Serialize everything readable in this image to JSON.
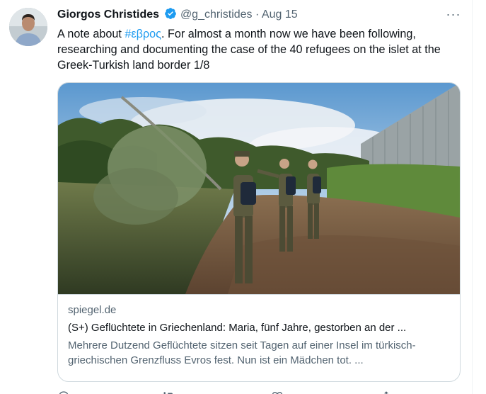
{
  "tweet": {
    "author_name": "Giorgos Christides",
    "handle": "@g_christides",
    "separator": "·",
    "date": "Aug 15",
    "more_glyph": "···",
    "text_hashtag": "#εβρος",
    "text_lead": "A note about ",
    "text_rest": ".  For almost a month now we have been following, researching and documenting the case of the 40 refugees on the islet at the Greek-Turkish land border 1/8"
  },
  "card": {
    "domain": "spiegel.de",
    "title": "(S+) Geflüchtete in Griechenland: Maria, fünf Jahre, gestorben an der ...",
    "description": "Mehrere Dutzend Geflüchtete sitzen seit Tagen auf einer Insel im türkisch-griechischen Grenzfluss Evros fest. Nun ist ein Mädchen tot. ..."
  },
  "colors": {
    "accent": "#1d9bf0",
    "text_primary": "#0f1419",
    "text_secondary": "#536471",
    "border": "#cfd9de"
  },
  "icons": [
    "verified-badge-icon",
    "more-icon",
    "reply-icon",
    "retweet-icon",
    "like-icon",
    "share-icon"
  ]
}
